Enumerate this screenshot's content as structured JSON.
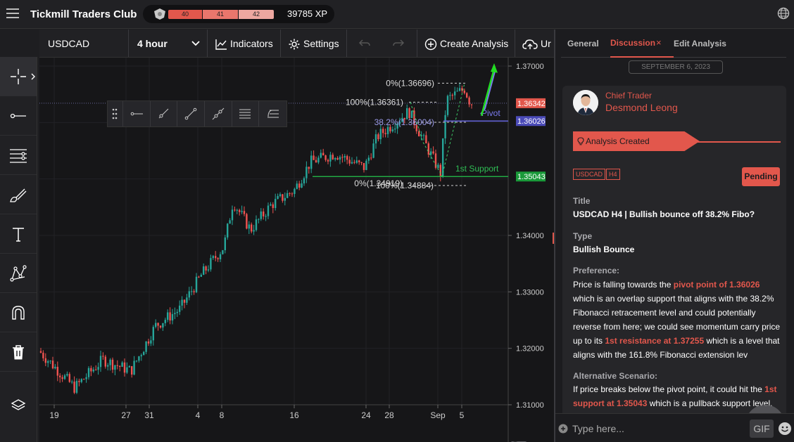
{
  "app": {
    "title": "Tickmill Traders Club"
  },
  "xp": {
    "levels": [
      "40",
      "41",
      "42"
    ],
    "value": "39785 XP"
  },
  "toolbar": {
    "symbol": "USDCAD",
    "timeframe": "4 hour",
    "indicators_label": "Indicators",
    "settings_label": "Settings",
    "create_label": "Create Analysis",
    "upload_label": "Ur"
  },
  "chart": {
    "price_ticks": [
      "1.37000",
      "1.34000",
      "1.33000",
      "1.32000",
      "1.31000"
    ],
    "date_ticks": [
      "19",
      "27",
      "31",
      "4",
      "8",
      "16",
      "24",
      "28",
      "Sep",
      "5"
    ],
    "price_labels": [
      {
        "text": "1.36342",
        "color": "#e2574c"
      },
      {
        "text": "1.36026",
        "color": "#4b4bb8"
      },
      {
        "text": "1.35043",
        "color": "#1a9a3a"
      }
    ],
    "annotations": {
      "fib_0_top": "0%(1.36696)",
      "fib_100": "100%(1.36361)",
      "fib_382": "38.2%(1.36004)",
      "fib_0_low": "0%(1.34919)",
      "fib_100_low": "100%(1.34884)",
      "pivot": "Pivot",
      "support": "1st Support"
    }
  },
  "panel": {
    "tabs": [
      {
        "label": "General"
      },
      {
        "label": "Discussion"
      },
      {
        "label": "Edit Analysis"
      }
    ],
    "tab_close": "×",
    "date": "SEPTEMBER 6, 2023",
    "author_role": "Chief Trader",
    "author_name": "Desmond Leong",
    "event": "Analysis Created",
    "tags": [
      "USDCAD",
      "H4"
    ],
    "status": "Pending",
    "title_label": "Title",
    "title_value": "USDCAD H4 | Bullish bounce off 38.2% Fibo?",
    "type_label": "Type",
    "type_value": "Bullish Bounce",
    "preference_label": "Preference:",
    "preference_parts": [
      "Price is falling towards the ",
      "pivot point of 1.36026",
      " which is an overlap support that aligns with the 38.2% Fibonacci retracement level and could potentially reverse from here; we could see momentum carry price up to its ",
      "1st resistance at 1.37255",
      " which is a level that aligns with the 161.8% Fibonacci extension lev"
    ],
    "alternative_label": "Alternative Scenario:",
    "alternative_parts": [
      "If price breaks below the pivot point, it could hit the ",
      "1st support at 1.35043",
      " which is a pullback support level."
    ],
    "input_placeholder": "Type here...",
    "gif_label": "GIF"
  },
  "colors": {
    "accent": "#e2574c",
    "up": "#26a69a",
    "down": "#ef5350",
    "pivot": "#6666dd",
    "support": "#22aa44"
  }
}
